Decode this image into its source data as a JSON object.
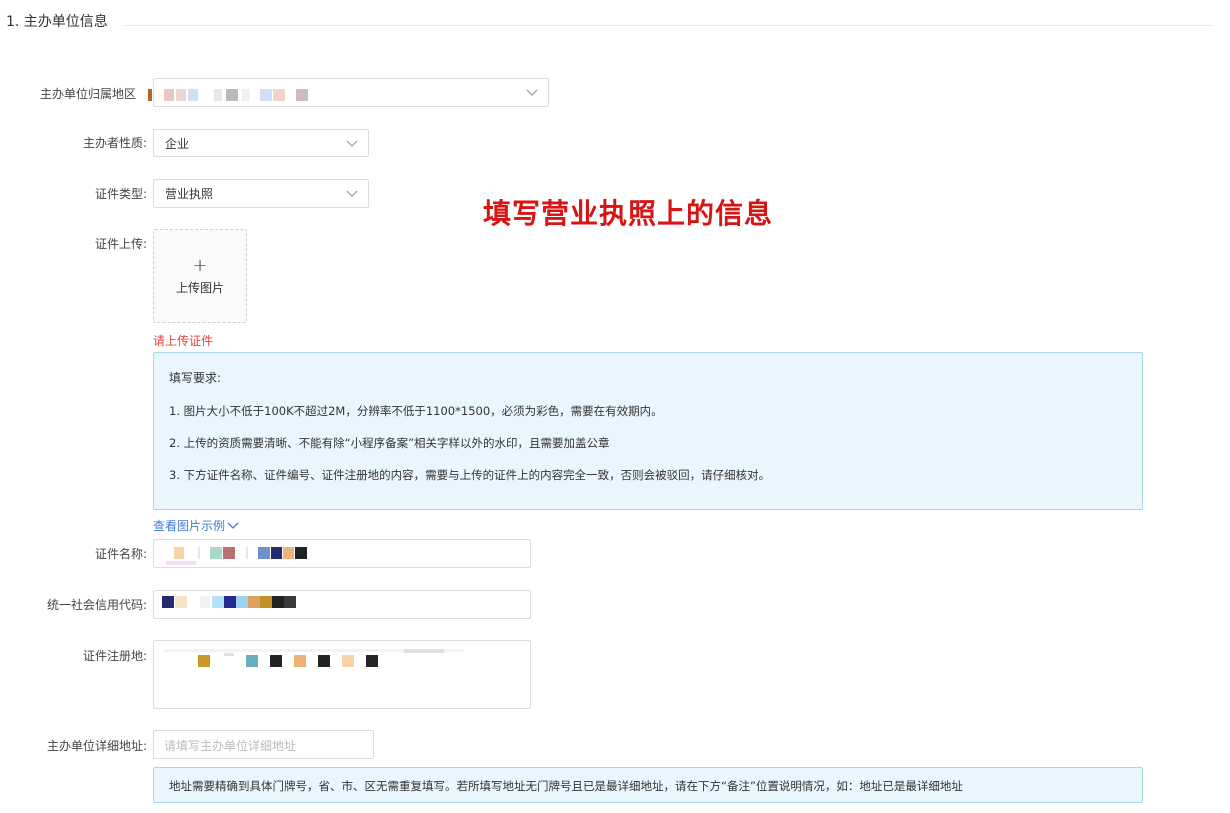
{
  "section": {
    "title": "1. 主办单位信息"
  },
  "fields": {
    "region": {
      "label": "主办单位归属地区"
    },
    "nature": {
      "label": "主办者性质:",
      "value": "企业"
    },
    "cert_type": {
      "label": "证件类型:",
      "value": "营业执照"
    },
    "cert_upload": {
      "label": "证件上传:",
      "plus": "+",
      "button": "上传图片",
      "error": "请上传证件"
    },
    "cert_name": {
      "label": "证件名称:"
    },
    "credit_code": {
      "label": "统一社会信用代码:"
    },
    "reg_address": {
      "label": "证件注册地:"
    },
    "detail_address": {
      "label": "主办单位详细地址:",
      "placeholder": "请填写主办单位详细地址"
    }
  },
  "requirements": {
    "title": "填写要求:",
    "lines": [
      "1. 图片大小不低于100K不超过2M，分辨率不低于1100*1500，必须为彩色，需要在有效期内。",
      "2. 上传的资质需要清晰、不能有除“小程序备案”相关字样以外的水印，且需要加盖公章",
      "3. 下方证件名称、证件编号、证件注册地的内容，需要与上传的证件上的内容完全一致，否则会被驳回，请仔细核对。"
    ]
  },
  "example_link": "查看图片示例",
  "overlay_annotation": "填写营业执照上的信息",
  "address_notice": "地址需要精确到具体门牌号，省、市、区无需重复填写。若所填写地址无门牌号且已是最详细地址，请在下方“备注”位置说明情况，如：地址已是最详细地址",
  "colors": {
    "error": "#e64340",
    "link": "#3f7cd5",
    "notice_bg": "#eaf6fd",
    "notice_border": "#a8d8ee",
    "annotation": "#d81414"
  }
}
